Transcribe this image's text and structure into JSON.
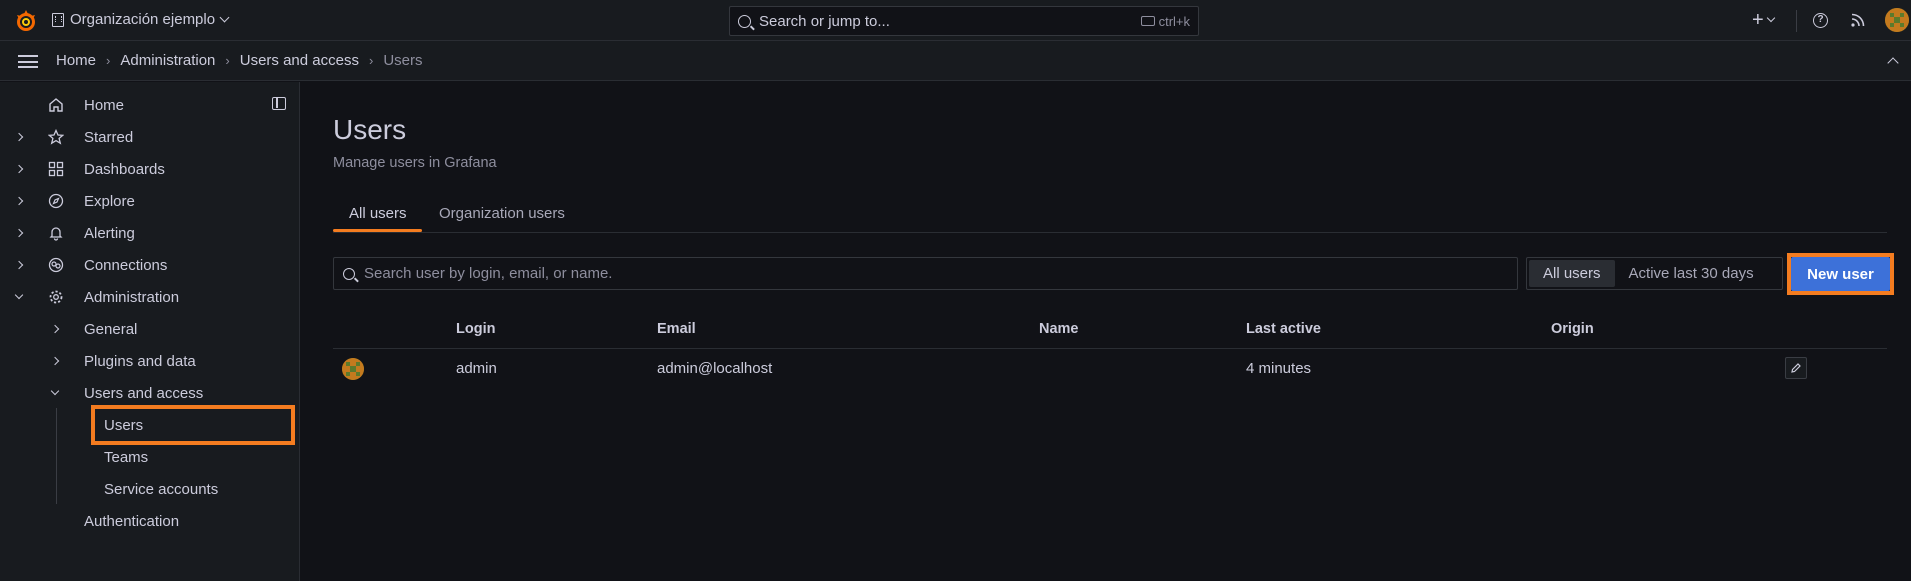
{
  "topbar": {
    "org_name": "Organización ejemplo",
    "search_placeholder": "Search or jump to...",
    "search_shortcut": "ctrl+k",
    "new_label": "+"
  },
  "breadcrumb": [
    "Home",
    "Administration",
    "Users and access",
    "Users"
  ],
  "sidebar": {
    "items": [
      {
        "label": "Home"
      },
      {
        "label": "Starred"
      },
      {
        "label": "Dashboards"
      },
      {
        "label": "Explore"
      },
      {
        "label": "Alerting"
      },
      {
        "label": "Connections"
      },
      {
        "label": "Administration"
      },
      {
        "label": "General"
      },
      {
        "label": "Plugins and data"
      },
      {
        "label": "Users and access"
      },
      {
        "label": "Users"
      },
      {
        "label": "Teams"
      },
      {
        "label": "Service accounts"
      },
      {
        "label": "Authentication"
      }
    ]
  },
  "page": {
    "title": "Users",
    "subtitle": "Manage users in Grafana",
    "tabs": [
      "All users",
      "Organization users"
    ],
    "search_placeholder": "Search user by login, email, or name.",
    "filter_options": [
      "All users",
      "Active last 30 days"
    ],
    "new_user_label": "New user"
  },
  "table": {
    "columns": [
      "Login",
      "Email",
      "Name",
      "Last active",
      "Origin"
    ],
    "rows": [
      {
        "login": "admin",
        "email": "admin@localhost",
        "name": "",
        "last_active": "4 minutes",
        "origin": ""
      }
    ]
  },
  "colors": {
    "accent": "#f47c20",
    "primary_button": "#3d71d9",
    "background": "#111217",
    "panel": "#181b1f"
  }
}
